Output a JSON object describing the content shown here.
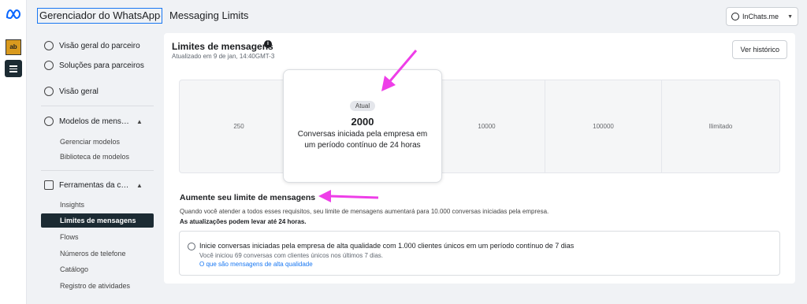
{
  "rail": {
    "app_avatar_label": "ab"
  },
  "header": {
    "crumb_root": "Gerenciador do WhatsApp",
    "crumb_separator": "›",
    "crumb_current": "Messaging Limits",
    "account_name": "InChats.me"
  },
  "sidebar": {
    "partner_overview": "Visão geral do parceiro",
    "partner_solutions": "Soluções para parceiros",
    "overview": "Visão geral",
    "templates_section": "Modelos de mens…",
    "templates_manage": "Gerenciar modelos",
    "templates_library": "Biblioteca de modelos",
    "tools_section": "Ferramentas da c…",
    "insights": "Insights",
    "messaging_limits": "Limites de mensagens",
    "flows": "Flows",
    "phone_numbers": "Números de telefone",
    "catalog": "Catálogo",
    "activity_log": "Registro de atividades"
  },
  "card": {
    "title": "Limites de mensagens",
    "info_icon": "i",
    "updated": "Atualizado em 9 de jan, 14:40GMT-3",
    "history_button": "Ver histórico"
  },
  "tiers": [
    "250",
    "2000",
    "10000",
    "100000",
    "Ilimitado"
  ],
  "current_tier": {
    "badge": "Atual",
    "value": "2000",
    "description": "Conversas iniciada pela empresa em um período contínuo de 24 horas"
  },
  "increase": {
    "title": "Aumente seu limite de mensagens",
    "description": "Quando você atender a todos esses requisitos, seu limite de mensagens aumentará para 10.000 conversas iniciadas pela empresa.",
    "note": "As atualizações podem levar até 24 horas."
  },
  "requirement": {
    "title": "Inicie conversas iniciadas pela empresa de alta qualidade com 1.000 clientes únicos em um período contínuo de 7 dias",
    "progress": "Você iniciou 69 conversas com clientes únicos nos últimos 7 dias.",
    "link": "O que são mensagens de alta qualidade"
  },
  "colors": {
    "accent": "#1877f2",
    "active_nav": "#1c2b33",
    "annotation": "#ee3ee8"
  },
  "icons": [
    "meta-logo-icon",
    "menu-icon",
    "whatsapp-icon",
    "chevron-down-icon",
    "info-icon",
    "people-icon",
    "link-icon",
    "dashboard-icon",
    "chat-icon",
    "briefcase-icon",
    "chevron-up-icon"
  ]
}
